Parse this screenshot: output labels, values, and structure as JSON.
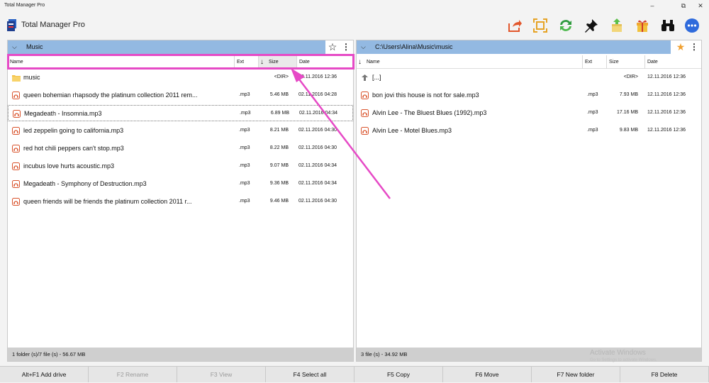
{
  "window": {
    "title": "Total Manager Pro",
    "controls": [
      "–",
      "⧉",
      "✕"
    ]
  },
  "toolbar": {
    "app_name": "Total Manager Pro",
    "buttons": [
      "share-icon",
      "select-frame-icon",
      "sync-icon",
      "pin-icon",
      "archive-icon",
      "gift-icon",
      "binoculars-icon",
      "more-icon"
    ]
  },
  "left": {
    "path": "Music",
    "columns": {
      "name": "Name",
      "ext": "Ext",
      "size": "Size",
      "date": "Date",
      "sort_arrow": "↓"
    },
    "rows": [
      {
        "name": "music",
        "ext": "",
        "size": "<DIR>",
        "date": "12.11.2016 12:36",
        "type": "folder"
      },
      {
        "name": "queen bohemian rhapsody the platinum collection 2011 rem...",
        "ext": ".mp3",
        "size": "5.46 MB",
        "date": "02.11.2016 04:28",
        "type": "audio"
      },
      {
        "name": "Megadeath - Insomnia.mp3",
        "ext": ".mp3",
        "size": "6.89 MB",
        "date": "02.11.2016 04:34",
        "type": "audio"
      },
      {
        "name": "led zeppelin going to california.mp3",
        "ext": ".mp3",
        "size": "8.21 MB",
        "date": "02.11.2016 04:30",
        "type": "audio"
      },
      {
        "name": "red hot chili peppers can't stop.mp3",
        "ext": ".mp3",
        "size": "8.22 MB",
        "date": "02.11.2016 04:30",
        "type": "audio"
      },
      {
        "name": "incubus love hurts acoustic.mp3",
        "ext": ".mp3",
        "size": "9.07 MB",
        "date": "02.11.2016 04:34",
        "type": "audio"
      },
      {
        "name": "Megadeath - Symphony of Destruction.mp3",
        "ext": ".mp3",
        "size": "9.36 MB",
        "date": "02.11.2016 04:34",
        "type": "audio"
      },
      {
        "name": "queen friends will be friends the platinum collection 2011 r...",
        "ext": ".mp3",
        "size": "9.46 MB",
        "date": "02.11.2016 04:30",
        "type": "audio"
      }
    ],
    "status": "1 folder (s)/7 file (s) - 56.67 MB"
  },
  "right": {
    "path": "C:\\Users\\Alina\\Music\\music",
    "columns": {
      "name": "Name",
      "ext": "Ext",
      "size": "Size",
      "date": "Date",
      "sort_arrow": "↓"
    },
    "rows": [
      {
        "name": "[...]",
        "ext": "",
        "size": "<DIR>",
        "date": "12.11.2016 12:36",
        "type": "up"
      },
      {
        "name": "bon jovi this house is not for sale.mp3",
        "ext": ".mp3",
        "size": "7.93 MB",
        "date": "12.11.2016 12:36",
        "type": "audio"
      },
      {
        "name": "Alvin Lee - The Bluest Blues (1992).mp3",
        "ext": ".mp3",
        "size": "17.16 MB",
        "date": "12.11.2016 12:36",
        "type": "audio"
      },
      {
        "name": "Alvin Lee - Motel Blues.mp3",
        "ext": ".mp3",
        "size": "9.83 MB",
        "date": "12.11.2016 12:36",
        "type": "audio"
      }
    ],
    "status": "3 file (s) - 34.92 MB"
  },
  "fkeys": [
    {
      "label": "Alt+F1  Add drive",
      "enabled": true
    },
    {
      "label": "F2  Rename",
      "enabled": false
    },
    {
      "label": "F3  View",
      "enabled": false
    },
    {
      "label": "F4  Select all",
      "enabled": true
    },
    {
      "label": "F5  Copy",
      "enabled": true
    },
    {
      "label": "F6  Move",
      "enabled": true
    },
    {
      "label": "F7  New folder",
      "enabled": true
    },
    {
      "label": "F8  Delete",
      "enabled": true
    }
  ],
  "watermark": {
    "title": "Activate Windows",
    "sub": "Go to Settings to activate Windows."
  },
  "colors": {
    "highlight": "#e64ac6",
    "panel_header": "#93b9e2",
    "star": "#f0a030"
  }
}
